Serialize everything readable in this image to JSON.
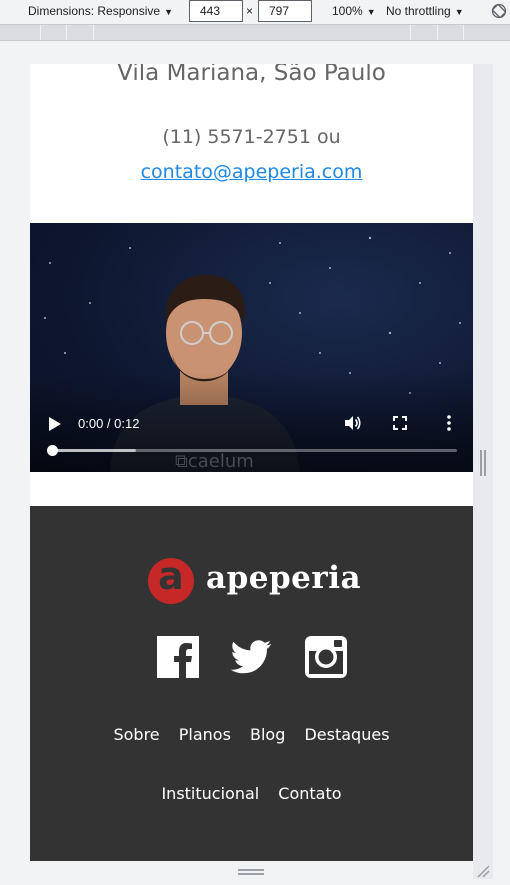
{
  "devtools": {
    "dimensions_label": "Dimensions: Responsive",
    "width": "443",
    "times": "×",
    "height": "797",
    "zoom": "100%",
    "throttling": "No throttling",
    "caret": "▼"
  },
  "contact": {
    "address": "Vila Mariana, São Paulo",
    "phone": "(11) 5571-2751 ou",
    "email": "contato@apeperia.com"
  },
  "video": {
    "time": "0:00 / 0:12",
    "progress_fraction": 0,
    "buffered_fraction": 0.21
  },
  "footer": {
    "logo_letter": "a",
    "logo_text": "apeperia",
    "social": [
      "facebook-icon",
      "twitter-icon",
      "instagram-icon"
    ],
    "nav_row1": [
      "Sobre",
      "Planos",
      "Blog",
      "Destaques"
    ],
    "nav_row2": [
      "Institucional",
      "Contato"
    ]
  },
  "colors": {
    "footer_bg": "#333333",
    "brand_red": "#c62828",
    "link_blue": "#1e88e5"
  }
}
